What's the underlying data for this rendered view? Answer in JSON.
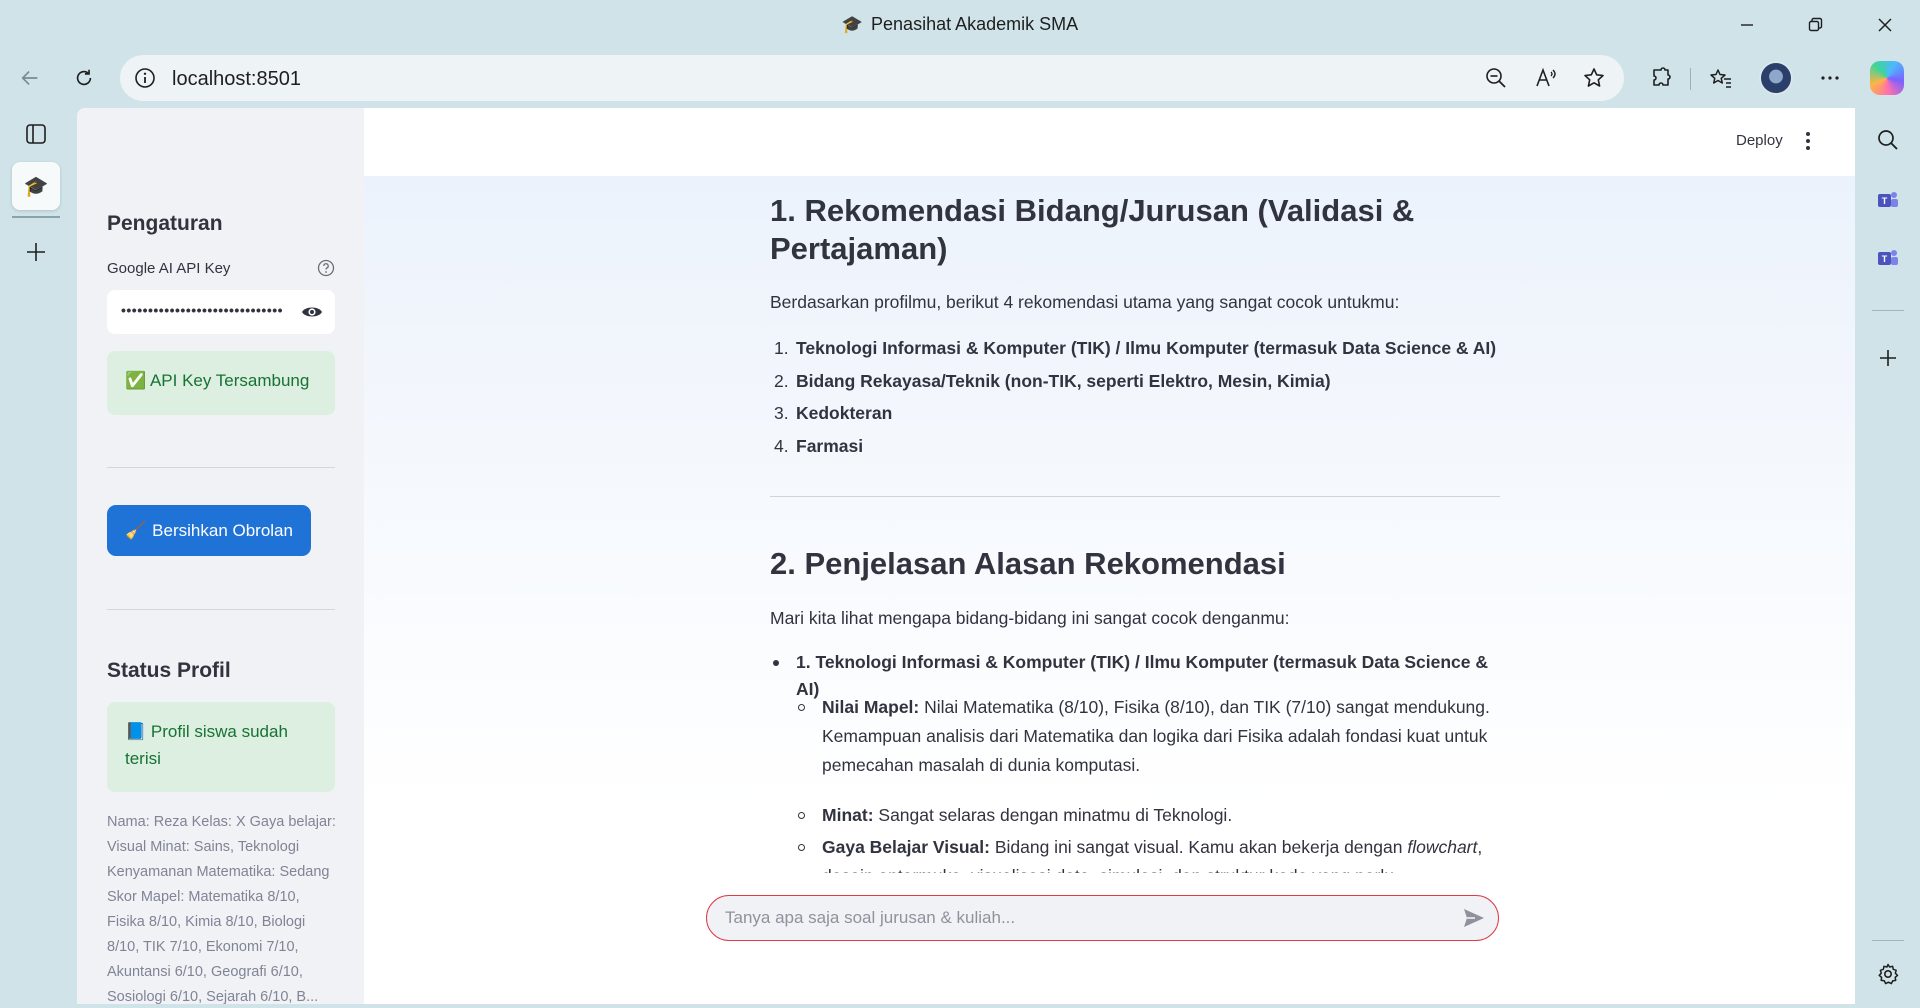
{
  "window": {
    "title": "Penasihat Akademik SMA",
    "title_icon": "graduation-cap-icon"
  },
  "browser": {
    "url": "localhost:8501",
    "icons": [
      "back-icon",
      "refresh-icon",
      "site-info-icon",
      "zoom-out-icon",
      "read-aloud-icon",
      "favorite-star-icon",
      "extensions-icon",
      "favorites-icon",
      "profile-avatar",
      "more-icon",
      "copilot-icon"
    ]
  },
  "sidebar": {
    "settings_title": "Pengaturan",
    "api_key_label": "Google AI API Key",
    "api_key_value": "••••••••••••••••••••••••••••••",
    "api_status": "✅ API Key Tersambung",
    "clear_button": "Bersihkan Obrolan",
    "clear_button_icon": "🧹",
    "profile_status_title": "Status Profil",
    "profile_status": "📘 Profil siswa sudah terisi",
    "profile_summary": "Nama: Reza Kelas: X Gaya belajar: Visual Minat: Sains, Teknologi Kenyamanan Matematika: Sedang Skor Mapel: Matematika 8/10, Fisika 8/10, Kimia 8/10, Biologi 8/10, TIK 7/10, Ekonomi 7/10, Akuntansi 6/10, Geografi 6/10, Sosiologi 6/10, Sejarah 6/10, B..."
  },
  "header": {
    "deploy_label": "Deploy"
  },
  "main": {
    "section1_title": "1. Rekomendasi Bidang/Jurusan (Validasi & Pertajaman)",
    "section1_intro": "Berdasarkan profilmu, berikut 4 rekomendasi utama yang sangat cocok untukmu:",
    "recommendations": [
      {
        "num": "1.",
        "text": "Teknologi Informasi & Komputer (TIK) / Ilmu Komputer (termasuk Data Science & AI)"
      },
      {
        "num": "2.",
        "text": "Bidang Rekayasa/Teknik (non-TIK, seperti Elektro, Mesin, Kimia)"
      },
      {
        "num": "3.",
        "text": "Kedokteran"
      },
      {
        "num": "4.",
        "text": "Farmasi"
      }
    ],
    "section2_title": "2. Penjelasan Alasan Rekomendasi",
    "section2_intro": "Mari kita lihat mengapa bidang-bidang ini sangat cocok denganmu:",
    "reason1_title": "1. Teknologi Informasi & Komputer (TIK) / Ilmu Komputer (termasuk Data Science & AI)",
    "reason1_points": [
      {
        "label": "Nilai Mapel:",
        "text": " Nilai Matematika (8/10), Fisika (8/10), dan TIK (7/10) sangat mendukung. Kemampuan analisis dari Matematika dan logika dari Fisika adalah fondasi kuat untuk pemecahan masalah di dunia komputasi."
      },
      {
        "label": "Minat:",
        "text": " Sangat selaras dengan minatmu di Teknologi."
      },
      {
        "label": "Gaya Belajar Visual:",
        "text_before": " Bidang ini sangat visual. Kamu akan bekerja dengan ",
        "italic": "flowchart",
        "text_after": ", desain antarmuka, visualisasi data, simulasi, dan struktur kode yang perlu dibayangkan."
      }
    ]
  },
  "chat": {
    "placeholder": "Tanya apa saja soal jurusan & kuliah..."
  },
  "colors": {
    "primary_button": "#1f72d6",
    "success_bg": "#dcefe1",
    "success_text": "#177233",
    "chat_border": "#e03a46",
    "sidebar_bg": "#f0f2f6"
  }
}
